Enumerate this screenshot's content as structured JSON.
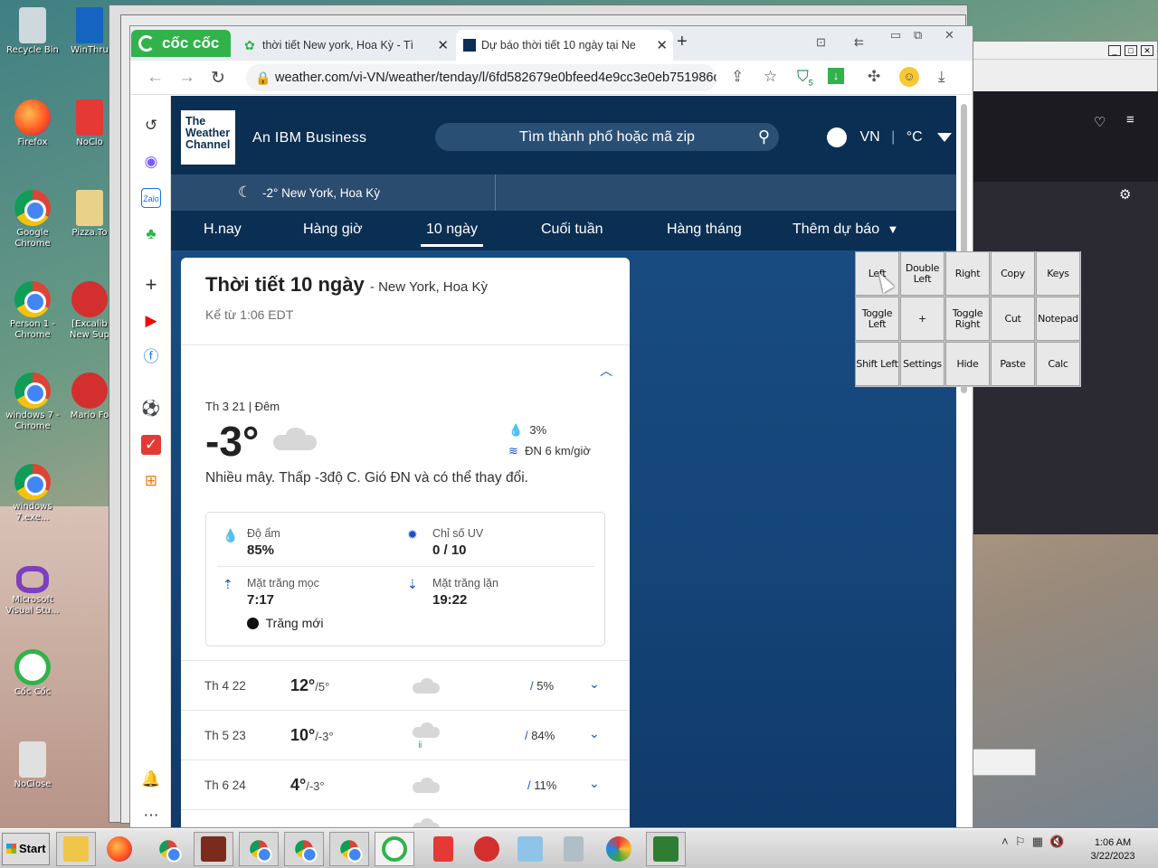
{
  "desktop": {
    "icons": [
      {
        "label": "Recycle Bin"
      },
      {
        "label": "WinThru"
      },
      {
        "label": "Firefox"
      },
      {
        "label": "NoClo"
      },
      {
        "label": "Google Chrome"
      },
      {
        "label": "Pizza.To"
      },
      {
        "label": "Person 1 - Chrome"
      },
      {
        "label": "[Excalib New Sup"
      },
      {
        "label": "windows 7 - Chrome"
      },
      {
        "label": "Mario Fo"
      },
      {
        "label": "windows 7.exe..."
      },
      {
        "label": "Microsoft Visual Stu..."
      },
      {
        "label": "Cốc Cốc"
      },
      {
        "label": "NoClose"
      }
    ]
  },
  "browser": {
    "brand": "cốc cốc",
    "tabs": [
      {
        "title": "thời tiết New york, Hoa Kỳ - Tì"
      },
      {
        "title": "Dự báo thời tiết 10 ngày tại Ne"
      }
    ],
    "url": "weather.com/vi-VN/weather/tenday/l/6fd582679e0bfeed4e9cc3e0eb751986c...",
    "badge": "5"
  },
  "site": {
    "logo_lines": [
      "The",
      "Weather",
      "Channel"
    ],
    "tagline": "An IBM Business",
    "search_placeholder": "Tìm thành phố hoặc mã zip",
    "country": "VN",
    "unit": "°C",
    "current_location": "-2° New York, Hoa Kỳ",
    "nav": [
      "H.nay",
      "Hàng giờ",
      "10 ngày",
      "Cuối tuần",
      "Hàng tháng",
      "Thêm dự báo"
    ]
  },
  "forecast": {
    "title": "Thời tiết 10 ngày",
    "location": "- New York, Hoa Kỳ",
    "since": "Kể từ 1:06 EDT",
    "today": {
      "label": "Th 3 21 | Đêm",
      "temp": "-3°",
      "precip": "3%",
      "wind": "ĐN 6 km/giờ",
      "narrative": "Nhiều mây. Thấp -3độ C. Gió ĐN và có thể thay đổi.",
      "humidity_label": "Độ ẩm",
      "humidity": "85%",
      "uv_label": "Chỉ số UV",
      "uv": "0 / 10",
      "moonrise_label": "Mặt trăng mọc",
      "moonrise": "7:17",
      "moonset_label": "Mặt trăng lặn",
      "moonset": "19:22",
      "moon_phase": "Trăng mới"
    },
    "days": [
      {
        "day": "Th 4 22",
        "hi": "12°",
        "lo": "/5°",
        "precip": "5%"
      },
      {
        "day": "Th 5 23",
        "hi": "10°",
        "lo": "/-3°",
        "precip": "84%"
      },
      {
        "day": "Th 6 24",
        "hi": "4°",
        "lo": "/-3°",
        "precip": "11%"
      }
    ]
  },
  "keypad": {
    "keys": [
      "Left",
      "Double Left",
      "Right",
      "Copy",
      "Keys",
      "Toggle Left",
      "+",
      "Toggle Right",
      "Cut",
      "Notepad",
      "Shift Left",
      "Settings",
      "Hide",
      "Paste",
      "Calc"
    ]
  },
  "taskbar": {
    "start": "Start",
    "time": "1:06 AM",
    "date": "3/22/2023"
  },
  "colors": {
    "weather_header": "#0b2f52",
    "weather_bg": "#15457a",
    "coccoc_green": "#31b24b",
    "accent_blue": "#1b4fc4"
  }
}
